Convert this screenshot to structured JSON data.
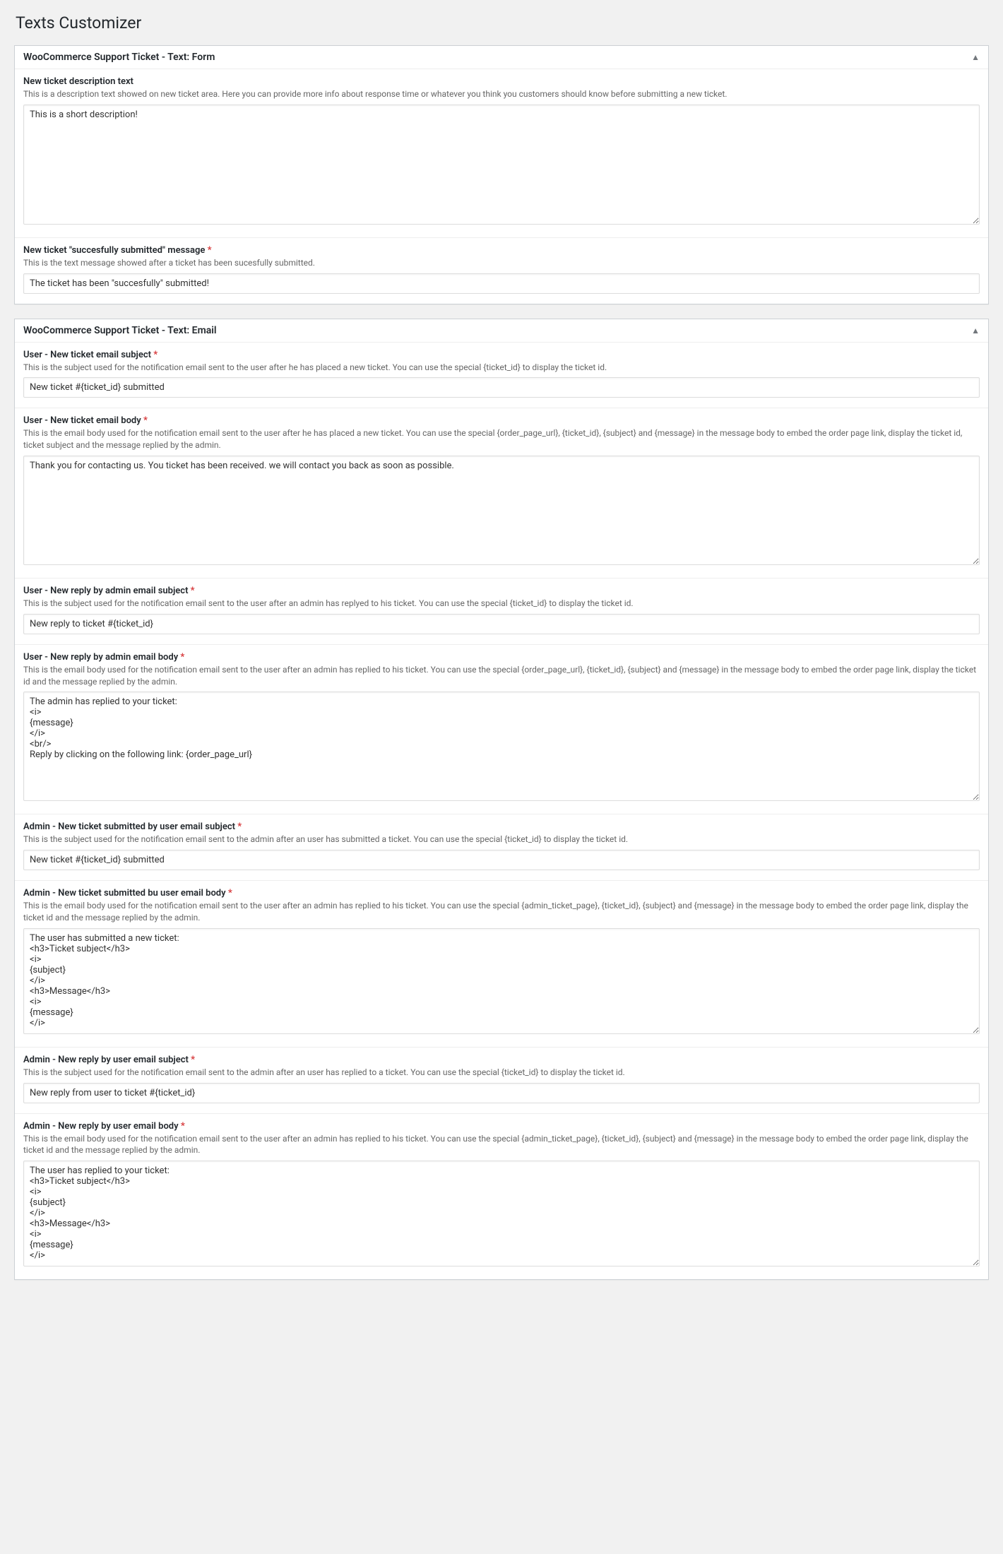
{
  "page": {
    "title": "Texts Customizer"
  },
  "panel_form": {
    "title": "WooCommerce Support Ticket - Text: Form",
    "fields": {
      "new_ticket_desc": {
        "label": "New ticket description text",
        "desc": "This is a description text showed on new ticket area. Here you can provide more info about response time or whatever you think you customers should know before submitting a new ticket.",
        "value": "This is a short description!"
      },
      "submitted_msg": {
        "label": "New ticket \"succesfully submitted\" message",
        "desc": "This is the text message showed after a ticket has been sucesfully submitted.",
        "value": "The ticket has been \"succesfully\" submitted!"
      }
    }
  },
  "panel_email": {
    "title": "WooCommerce Support Ticket - Text: Email",
    "fields": {
      "user_new_subject": {
        "label": "User - New ticket email subject",
        "desc": "This is the subject used for the notification email sent to the user after he has placed a new ticket. You can use the special {ticket_id} to display the ticket id.",
        "value": "New ticket #{ticket_id} submitted"
      },
      "user_new_body": {
        "label": "User - New ticket email body",
        "desc": "This is the email body used for the notification email sent to the user after he has placed a new ticket. You can use the special {order_page_url}, {ticket_id}, {subject} and {message} in the message body to embed the order page link, display the ticket id, ticket subject and the message replied by the admin.",
        "value": "Thank you for contacting us. You ticket has been received. we will contact you back as soon as possible."
      },
      "user_reply_subject": {
        "label": "User - New reply by admin email subject",
        "desc": "This is the subject used for the notification email sent to the user after an admin has replyed to his ticket. You can use the special {ticket_id} to display the ticket id.",
        "value": "New reply to ticket #{ticket_id}"
      },
      "user_reply_body": {
        "label": "User - New reply by admin email body",
        "desc": "This is the email body used for the notification email sent to the user after an admin has replied to his ticket. You can use the special {order_page_url}, {ticket_id}, {subject} and {message} in the message body to embed the order page link, display the ticket id and the message replied by the admin.",
        "value": "The admin has replied to your ticket:\n<i>\n{message}\n</i>\n<br/>\nReply by clicking on the following link: {order_page_url}"
      },
      "admin_new_subject": {
        "label": "Admin - New ticket submitted by user email subject",
        "desc": "This is the subject used for the notification email sent to the admin after an user has submitted a ticket. You can use the special {ticket_id} to display the ticket id.",
        "value": "New ticket #{ticket_id} submitted"
      },
      "admin_new_body": {
        "label": "Admin - New ticket submitted bu user email body",
        "desc": "This is the email body used for the notification email sent to the user after an admin has replied to his ticket. You can use the special {admin_ticket_page}, {ticket_id}, {subject} and {message} in the message body to embed the order page link, display the ticket id and the message replied by the admin.",
        "value": "The user has submitted a new ticket:\n<h3>Ticket subject</h3>\n<i>\n{subject}\n</i>\n<h3>Message</h3>\n<i>\n{message}\n</i>"
      },
      "admin_reply_subject": {
        "label": "Admin - New reply by user email subject",
        "desc": "This is the subject used for the notification email sent to the admin after an user has replied to a ticket. You can use the special {ticket_id} to display the ticket id.",
        "value": "New reply from user to ticket #{ticket_id}"
      },
      "admin_reply_body": {
        "label": "Admin - New reply by user email body",
        "desc": "This is the email body used for the notification email sent to the user after an admin has replied to his ticket. You can use the special {admin_ticket_page}, {ticket_id}, {subject} and {message} in the message body to embed the order page link, display the ticket id and the message replied by the admin.",
        "value": "The user has replied to your ticket:\n<h3>Ticket subject</h3>\n<i>\n{subject}\n</i>\n<h3>Message</h3>\n<i>\n{message}\n</i>"
      }
    }
  }
}
